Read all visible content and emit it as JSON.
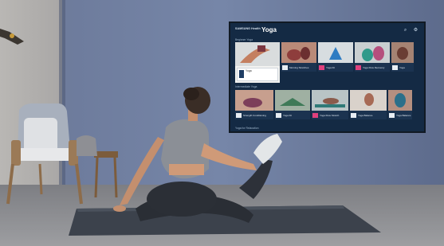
{
  "tv": {
    "brand": "SAMSUNG Health",
    "title": "Yoga",
    "header_icons": [
      "search-icon",
      "settings-icon"
    ],
    "sections": [
      "Beginner Yoga",
      "Intermediate Yoga",
      "Yoga for Relaxation"
    ],
    "row1": {
      "featured": {
        "title": "Yoga",
        "line1": "",
        "line2": ""
      },
      "cards": [
        {
          "label": "Morning Stretches",
          "chip": "white"
        },
        {
          "label": "Yoga Fit",
          "chip": "pink"
        },
        {
          "label": "Yoga Flow Recovery",
          "chip": "pink"
        },
        {
          "label": "Yoga",
          "chip": "white"
        }
      ]
    },
    "row2": {
      "cards": [
        {
          "label": "Strength Conditioning",
          "chip": "white"
        },
        {
          "label": "Yoga Fit",
          "chip": "white"
        },
        {
          "label": "Yoga Flow Stretch",
          "chip": "pink"
        },
        {
          "label": "Yoga Balance",
          "chip": "white"
        },
        {
          "label": "Yoga Balance",
          "chip": "white"
        }
      ]
    }
  },
  "colors": {
    "wall": "#6f7fa0",
    "floor": "#8e8e90",
    "mat": "#3f4650",
    "tv_bg": "#142a44",
    "accent_pink": "#e0407d"
  }
}
